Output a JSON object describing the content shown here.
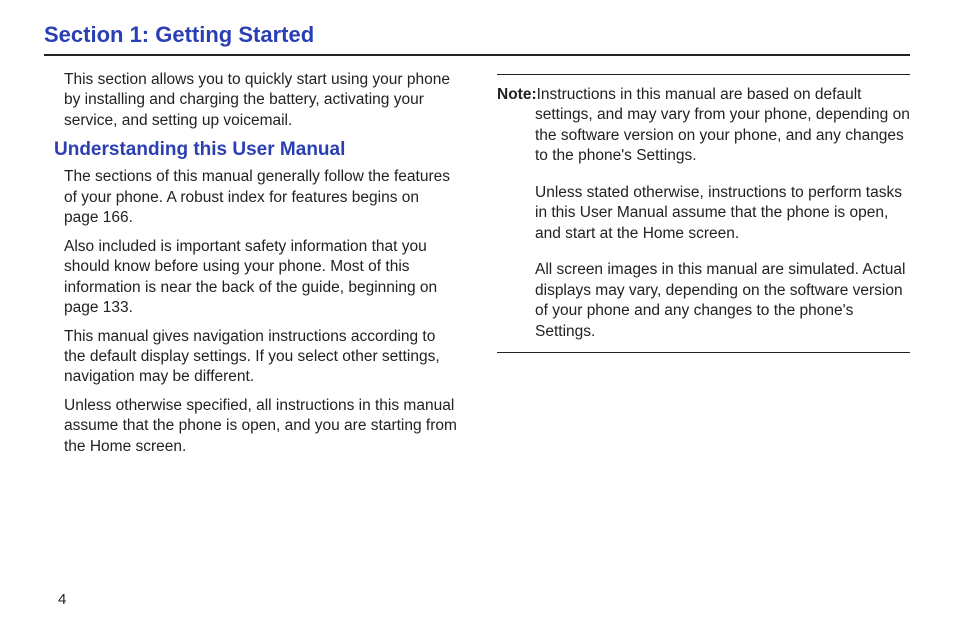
{
  "section_title": "Section 1: Getting Started",
  "intro": "This section allows you to quickly start using your phone by installing and charging the battery, activating your service, and setting up voicemail.",
  "sub_title": "Understanding this User Manual",
  "paragraphs": [
    "The sections of this manual generally follow the features of your phone. A robust index for features begins on page 166.",
    "Also included is important safety information that you should know before using your phone. Most of this information is near the back of the guide, beginning on page 133.",
    "This manual gives navigation instructions according to the default display settings. If you select other settings, navigation may be different.",
    "Unless otherwise specified, all instructions in this manual assume that the phone is open, and you are starting from the Home screen."
  ],
  "note_label": "Note:",
  "note_paragraphs": [
    "Instructions in this manual are based on default settings, and may vary from your phone, depending on the software version on your phone, and any changes to the phone's Settings.",
    "Unless stated otherwise, instructions to perform tasks in this User Manual assume that the phone is open, and start at the Home screen.",
    "All screen images in this manual are simulated. Actual displays may vary, depending on the software version of your phone and any changes to the phone's Settings."
  ],
  "page_number": "4"
}
